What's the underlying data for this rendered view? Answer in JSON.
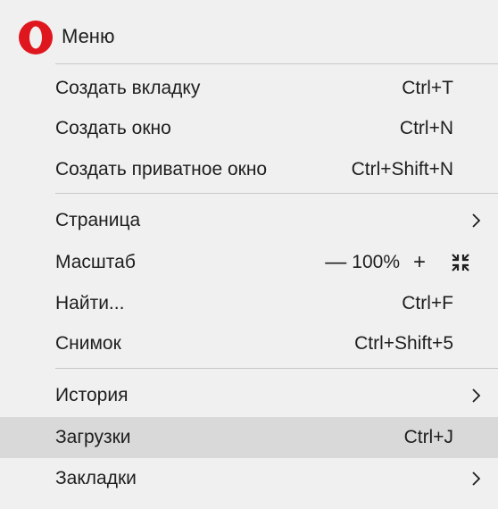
{
  "header": {
    "title": "Меню",
    "logo_icon": "opera-logo-icon",
    "logo_color": "#e0161f"
  },
  "sections": [
    {
      "items": [
        {
          "label": "Создать вкладку",
          "shortcut": "Ctrl+T"
        },
        {
          "label": "Создать окно",
          "shortcut": "Ctrl+N"
        },
        {
          "label": "Создать приватное окно",
          "shortcut": "Ctrl+Shift+N"
        }
      ]
    }
  ],
  "page_item": {
    "label": "Страница",
    "icon": "chevron-right-icon"
  },
  "zoom_item": {
    "label": "Масштаб",
    "minus": "—",
    "value": "100%",
    "plus": "+",
    "fullscreen_icon": "fullscreen-exit-icon"
  },
  "find_item": {
    "label": "Найти...",
    "shortcut": "Ctrl+F"
  },
  "snapshot_item": {
    "label": "Снимок",
    "shortcut": "Ctrl+Shift+5"
  },
  "history_item": {
    "label": "История",
    "icon": "chevron-right-icon"
  },
  "downloads_item": {
    "label": "Загрузки",
    "shortcut": "Ctrl+J",
    "highlighted": true
  },
  "bookmarks_item": {
    "label": "Закладки",
    "icon": "chevron-right-icon"
  },
  "colors": {
    "background": "#f0f0f0",
    "highlight": "#d9d9d9",
    "divider": "#c8c8c8",
    "brand": "#e0161f"
  }
}
